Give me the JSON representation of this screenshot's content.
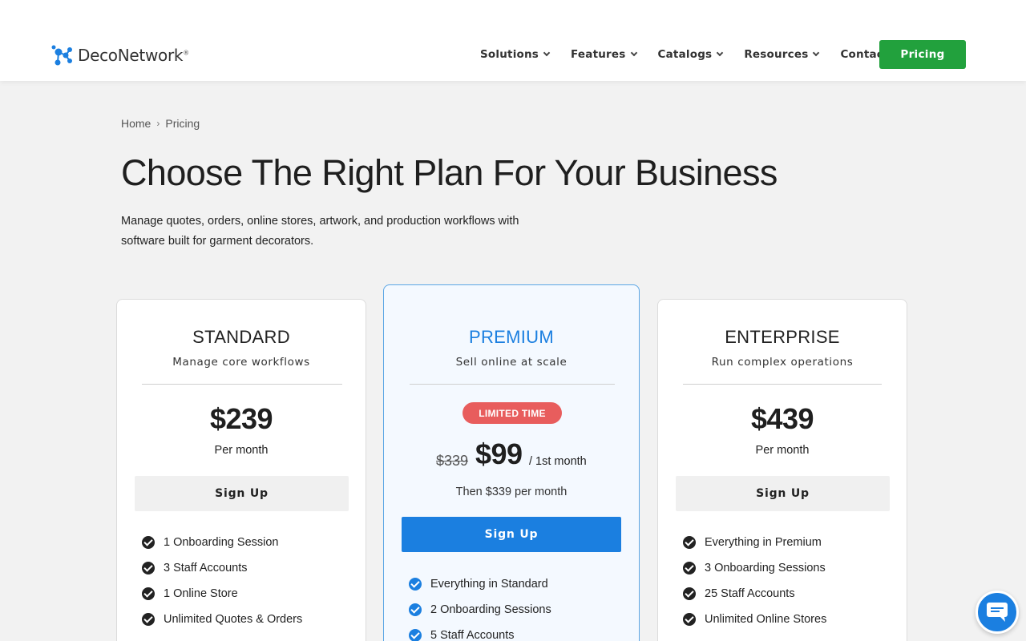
{
  "header": {
    "logo_text": "DecoNetwork",
    "logo_reg": "®",
    "nav": [
      {
        "label": "Solutions"
      },
      {
        "label": "Features"
      },
      {
        "label": "Catalogs"
      },
      {
        "label": "Resources"
      },
      {
        "label": "Contact Us"
      }
    ],
    "pricing_label": "Pricing"
  },
  "breadcrumb": {
    "home": "Home",
    "separator": "›",
    "current": "Pricing"
  },
  "page": {
    "title": "Choose The Right Plan For Your Business",
    "subtitle": "Manage quotes, orders, online stores, artwork, and production workflows with software built for garment decorators."
  },
  "plans": {
    "standard": {
      "name": "STANDARD",
      "tagline": "Manage core workflows",
      "price": "$239",
      "period": "Per month",
      "cta": "Sign Up",
      "features": [
        "1 Onboarding Session",
        "3 Staff Accounts",
        "1 Online Store",
        "Unlimited Quotes & Orders"
      ]
    },
    "premium": {
      "name": "PREMIUM",
      "tagline": "Sell online at scale",
      "badge": "LIMITED TIME",
      "old_price": "$339",
      "price": "$99",
      "period": "/ 1st month",
      "then": "Then $339 per month",
      "cta": "Sign Up",
      "features": [
        "Everything in Standard",
        "2 Onboarding Sessions",
        "5 Staff Accounts"
      ]
    },
    "enterprise": {
      "name": "ENTERPRISE",
      "tagline": "Run complex operations",
      "price": "$439",
      "period": "Per month",
      "cta": "Sign Up",
      "features": [
        "Everything in Premium",
        "3 Onboarding Sessions",
        "25 Staff Accounts",
        "Unlimited Online Stores"
      ]
    }
  },
  "colors": {
    "brand_green": "#22a13d",
    "accent_blue": "#1b7fe0",
    "premium_title": "#1b7fe0",
    "badge_red": "#e85d5d"
  },
  "icons": {
    "logo": "deconetwork-molecule-icon",
    "check": "check-circle-icon",
    "chat": "chat-bubble-icon"
  }
}
